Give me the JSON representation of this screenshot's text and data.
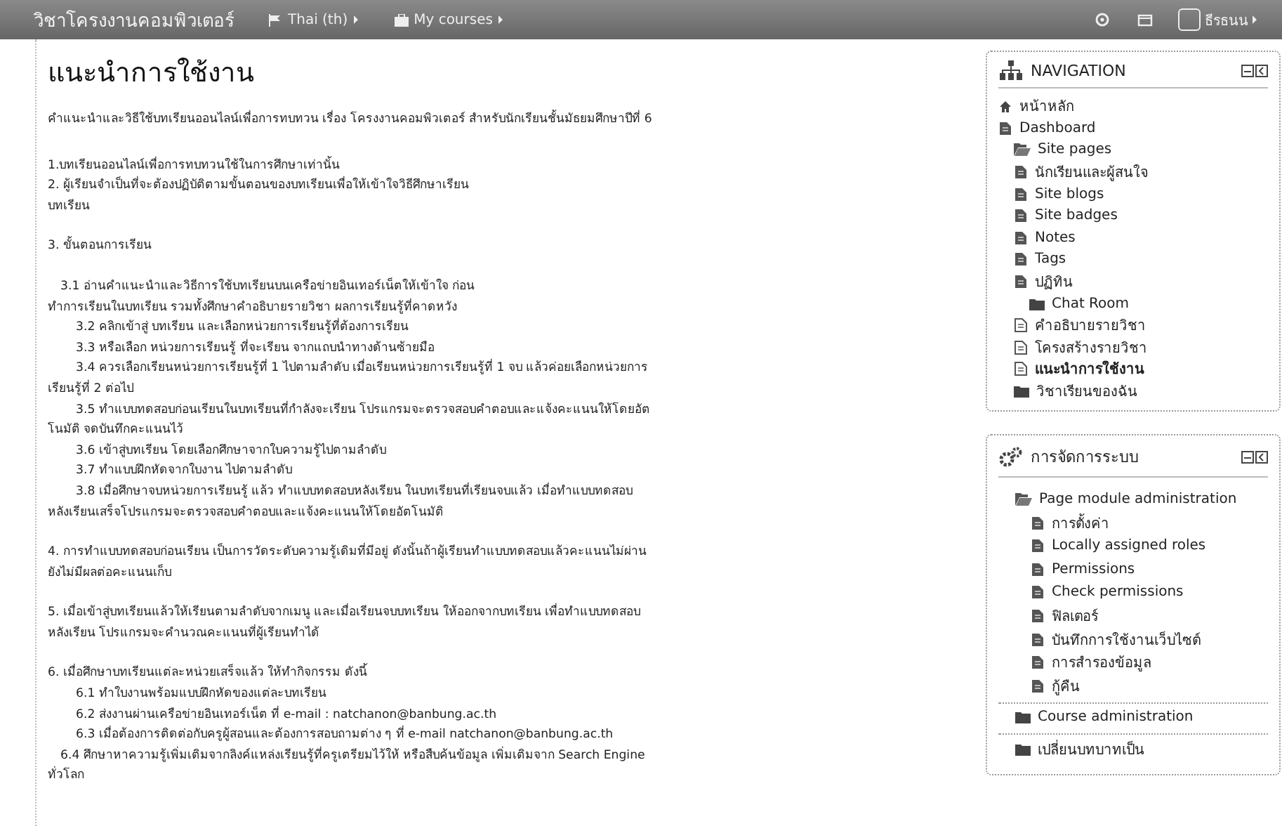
{
  "header": {
    "site_name": "วิชาโครงงานคอมพิวเตอร์",
    "menus": [
      {
        "label": "Thai (th)",
        "kind": "language"
      },
      {
        "label": "My courses",
        "kind": "courses"
      }
    ],
    "user_name": "ธีรธนน"
  },
  "content": {
    "title": "แนะนำการใช้งาน",
    "paragraphs": [
      {
        "lines": [
          {
            "kind": "plain",
            "text": "คำแนะนำและวิธีใช้บทเรียนออนไลน์เพื่อการทบทวน เรื่อง โครงงานคอมพิวเตอร์ สำหรับนักเรียนชั้นมัธยมศึกษาปีที่ 6"
          }
        ]
      },
      {
        "lines": [
          {
            "kind": "plain",
            "text": "1.บทเรียนออนไลน์เพื่อการทบทวนใช้ในการศึกษาเท่านั้น"
          },
          {
            "kind": "plain",
            "text": "2. ผู้เรียนจำเป็นที่จะต้องปฏิบัติตามขั้นตอนของบทเรียนเพื่อให้เข้าใจวิธีศึกษาเรียน"
          },
          {
            "kind": "plain",
            "text": "บทเรียน"
          }
        ]
      },
      {
        "lines": [
          {
            "kind": "plain",
            "text": "3. ขั้นตอนการเรียน"
          }
        ]
      },
      {
        "lines": [
          {
            "kind": "lead",
            "text": "3.1 อ่านคำแนะนำและวิธีการใช้บทเรียนบนเครือข่ายอินเทอร์เน็ตให้เข้าใจ ก่อน"
          },
          {
            "kind": "plain",
            "text": "ทำการเรียนในบทเรียน รวมทั้งศึกษาคำอธิบายรายวิชา ผลการเรียนรู้ที่คาดหวัง"
          },
          {
            "kind": "step",
            "text": "3.2 คลิกเข้าสู่ บทเรียน และเลือกหน่วยการเรียนรู้ที่ต้องการเรียน"
          },
          {
            "kind": "step",
            "text": "3.3 หรือเลือก หน่วยการเรียนรู้ ที่จะเรียน จากแถบนำทางด้านซ้ายมือ"
          },
          {
            "kind": "step",
            "text": "3.4 ควรเลือกเรียนหน่วยการเรียนรู้ที่ 1 ไปตามลำดับ เมื่อเรียนหน่วยการเรียนรู้ที่ 1 จบ แล้วค่อยเลือกหน่วยการ"
          },
          {
            "kind": "plain",
            "text": "เรียนรู้ที่ 2 ต่อไป"
          },
          {
            "kind": "step",
            "text": "3.5 ทำแบบทดสอบก่อนเรียนในบทเรียนที่กำลังจะเรียน โปรแกรมจะตรวจสอบคำตอบและแจ้งคะแนนให้โดยอัต"
          },
          {
            "kind": "plain",
            "text": "โนมัติ จดบันทึกคะแนนไว้"
          },
          {
            "kind": "step",
            "text": "3.6 เข้าสู่บทเรียน โดยเลือกศึกษาจากใบความรู้ไปตามลำดับ"
          },
          {
            "kind": "step",
            "text": "3.7 ทำแบบฝึกหัดจากใบงาน ไปตามลำดับ"
          },
          {
            "kind": "step",
            "text": "3.8 เมื่อศึกษาจบหน่วยการเรียนรู้ แล้ว ทำแบบทดสอบหลังเรียน ในบทเรียนที่เรียนจบแล้ว เมื่อทำแบบทดสอบ"
          },
          {
            "kind": "plain",
            "text": "หลังเรียนเสร็จโปรแกรมจะตรวจสอบคำตอบและแจ้งคะแนนให้โดยอัตโนมัติ"
          }
        ]
      },
      {
        "lines": [
          {
            "kind": "plain",
            "text": "4. การทำแบบทดสอบก่อนเรียน เป็นการวัดระดับความรู้เดิมที่มีอยู่ ดังนั้นถ้าผู้เรียนทำแบบทดสอบแล้วคะแนนไม่ผ่าน"
          },
          {
            "kind": "plain",
            "text": "ยังไม่มีผลต่อคะแนนเก็บ"
          }
        ]
      },
      {
        "lines": [
          {
            "kind": "plain",
            "text": "5. เมื่อเข้าสู่บทเรียนแล้วให้เรียนตามลำดับจากเมนู และเมื่อเรียนจบบทเรียน ให้ออกจากบทเรียน เพื่อทำแบบทดสอบ"
          },
          {
            "kind": "plain",
            "text": "หลังเรียน โปรแกรมจะคำนวณคะแนนที่ผู้เรียนทำได้"
          }
        ]
      },
      {
        "lines": [
          {
            "kind": "plain",
            "text": "6. เมื่อศึกษาบทเรียนแต่ละหน่วยเสร็จแล้ว ให้ทำกิจกรรม ดังนี้"
          },
          {
            "kind": "step",
            "text": "6.1 ทำใบงานพร้อมแบบฝึกหัดของแต่ละบทเรียน"
          },
          {
            "kind": "step",
            "text": "6.2 ส่งงานผ่านเครือข่ายอินเทอร์เน็ต ที่ e-mail : natchanon@banbung.ac.th"
          },
          {
            "kind": "step",
            "text": "6.3 เมื่อต้องการติดต่อกับครูผู้สอนและต้องการสอบถามต่าง ๆ ที่ e-mail natchanon@banbung.ac.th"
          },
          {
            "kind": "lead",
            "text": "6.4 ศึกษาหาความรู้เพิ่มเติมจากลิงค์แหล่งเรียนรู้ที่ครูเตรียมไว้ให้ หรือสืบค้นข้อมูล เพิ่มเติมจาก Search Engine"
          },
          {
            "kind": "plain",
            "text": "ทั่วโลก"
          }
        ]
      }
    ]
  },
  "navigation": {
    "title": "NAVIGATION",
    "items": [
      {
        "label": "หน้าหลัก",
        "kind": "home",
        "selected": false
      },
      {
        "label": "Dashboard",
        "kind": "page",
        "selected": false,
        "children": [
          {
            "label": "Site pages",
            "kind": "folder-open",
            "selected": false
          },
          {
            "label": "นักเรียนและผู้สนใจ",
            "kind": "page",
            "selected": false
          },
          {
            "label": "Site blogs",
            "kind": "page",
            "selected": false
          },
          {
            "label": "Site badges",
            "kind": "page",
            "selected": false
          },
          {
            "label": "Notes",
            "kind": "page",
            "selected": false
          },
          {
            "label": "Tags",
            "kind": "page",
            "selected": false
          },
          {
            "label": "ปฏิทิน",
            "kind": "page",
            "selected": false,
            "children": [
              {
                "label": "Chat Room",
                "kind": "folder",
                "selected": false
              }
            ]
          },
          {
            "label": "คำอธิบายรายวิชา",
            "kind": "doc",
            "selected": false
          },
          {
            "label": "โครงสร้างรายวิชา",
            "kind": "doc",
            "selected": false
          },
          {
            "label": "แนะนำการใช้งาน",
            "kind": "doc",
            "selected": true
          },
          {
            "label": "วิชาเรียนของฉัน",
            "kind": "folder",
            "selected": false
          }
        ]
      }
    ]
  },
  "administration": {
    "title": "การจัดการระบบ",
    "sections": [
      {
        "label": "Page module administration",
        "kind": "folder-open",
        "children": [
          {
            "label": "การตั้งค่า",
            "kind": "page"
          },
          {
            "label": "Locally assigned roles",
            "kind": "page"
          },
          {
            "label": "Permissions",
            "kind": "page"
          },
          {
            "label": "Check permissions",
            "kind": "page"
          },
          {
            "label": "ฟิลเตอร์",
            "kind": "page"
          },
          {
            "label": "บันทึกการใช้งานเว็บไซต์",
            "kind": "page"
          },
          {
            "label": "การสำรองข้อมูล",
            "kind": "page"
          },
          {
            "label": "กู้คืน",
            "kind": "page"
          }
        ]
      },
      {
        "label": "Course administration",
        "kind": "folder"
      },
      {
        "label": "เปลี่ยนบทบาทเป็น",
        "kind": "folder"
      }
    ]
  }
}
